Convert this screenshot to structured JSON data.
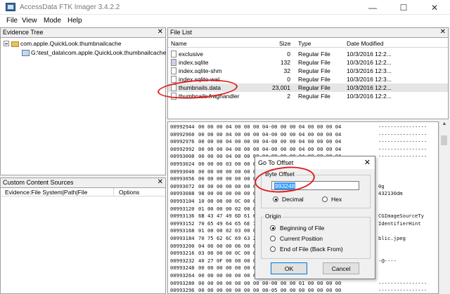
{
  "window": {
    "title": "AccessData FTK Imager 3.4.2.2"
  },
  "menu": [
    "File",
    "View",
    "Mode",
    "Help"
  ],
  "evidence_tree": {
    "header": "Evidence Tree",
    "items": [
      {
        "label": "com.apple.QuickLook.thumbnailcache",
        "icon": "folder-icon"
      },
      {
        "label": "G:\\test_data\\com.apple.QuickLook.thumbnailcache",
        "icon": "drive-icon"
      }
    ]
  },
  "file_list": {
    "header": "File List",
    "columns": [
      "Name",
      "Size",
      "Type",
      "Date Modified"
    ],
    "rows": [
      {
        "name": "exclusive",
        "size": "0",
        "type": "Regular File",
        "date": "10/3/2016 12:2..."
      },
      {
        "name": "index.sqlite",
        "size": "132",
        "type": "Regular File",
        "date": "10/3/2016 12:2..."
      },
      {
        "name": "index.sqlite-shm",
        "size": "32",
        "type": "Regular File",
        "date": "10/3/2016 12:3..."
      },
      {
        "name": "index.sqlite-wal",
        "size": "0",
        "type": "Regular File",
        "date": "10/3/2016 12:3..."
      },
      {
        "name": "thumbnails.data",
        "size": "23,001",
        "type": "Regular File",
        "date": "10/3/2016 12:2..."
      },
      {
        "name": "thumbnails.fraghandler",
        "size": "2",
        "type": "Regular File",
        "date": "10/3/2016 12:2..."
      }
    ]
  },
  "custom_content": {
    "header": "Custom Content Sources",
    "columns": [
      "Evidence:File System|Path|File",
      "Options"
    ]
  },
  "hex_view": {
    "rows": [
      {
        "offset": "00992944",
        "bytes": "00 00 00 04 00 00 00 04-00 00 00 04 00 00 00 04",
        "ascii": "----------------"
      },
      {
        "offset": "00992960",
        "bytes": "00 00 00 04 00 00 00 04-00 00 00 04 00 00 00 04",
        "ascii": "----------------"
      },
      {
        "offset": "00992976",
        "bytes": "00 00 00 04 00 00 00 04-00 00 00 04 00 00 00 04",
        "ascii": "----------------"
      },
      {
        "offset": "00992992",
        "bytes": "00 00 00 04 00 00 00 04-00 00 00 04 00 00 00 04",
        "ascii": "----------------"
      },
      {
        "offset": "00993008",
        "bytes": "00 00 00 04 00 00 00 04-00 00 00 04 00 00 00 04",
        "ascii": "----------------"
      },
      {
        "offset": "00993024",
        "bytes": "00 00 00 03 00 00 00",
        "ascii": ""
      },
      {
        "offset": "00993040",
        "bytes": "00 00 00 00 00 00 00",
        "ascii": ""
      },
      {
        "offset": "00993056",
        "bytes": "00 00 00 00 00 00 00",
        "ascii": ""
      },
      {
        "offset": "00993072",
        "bytes": "00 00 00 00 00 00 00",
        "ascii": "0g"
      },
      {
        "offset": "00993088",
        "bytes": "98 00 00 00 00 00 00",
        "ascii": "432130dm"
      },
      {
        "offset": "00993104",
        "bytes": "10 00 00 00 0C 00 00",
        "ascii": ""
      },
      {
        "offset": "00993120",
        "bytes": "01 00 00 00 02 00 00",
        "ascii": ""
      },
      {
        "offset": "00993136",
        "bytes": "6B 43 47 49 6D 61 67",
        "ascii": "CGImageSourceTy"
      },
      {
        "offset": "00993152",
        "bytes": "70 65 49 64 65 6E 74",
        "ascii": "IdentifierHint"
      },
      {
        "offset": "00993168",
        "bytes": "01 00 00 02 03 00 00",
        "ascii": ""
      },
      {
        "offset": "00993184",
        "bytes": "70 75 62 6C 69 63 2E",
        "ascii": "blic.jpeg"
      },
      {
        "offset": "00993200",
        "bytes": "04 00 00 00 06 00 00",
        "ascii": ""
      },
      {
        "offset": "00993216",
        "bytes": "03 00 00 00 0C 00 00",
        "ascii": ""
      },
      {
        "offset": "00993232",
        "bytes": "40 27 0F 00 00 00 00",
        "ascii": "-@----"
      },
      {
        "offset": "00993248",
        "bytes": "00 00 00 00 00 00 00",
        "ascii": ""
      },
      {
        "offset": "00993264",
        "bytes": "00 00 00 00 00 00 00",
        "ascii": ""
      },
      {
        "offset": "00993280",
        "bytes": "00 00 00 00 00 00 00 00-00 00 00 01 00 00 00 00",
        "ascii": "----------------"
      },
      {
        "offset": "00993296",
        "bytes": "00 00 00 00 00 00 00 00-05 00 00 00 00 00 00 00",
        "ascii": "----------------"
      }
    ]
  },
  "dialog": {
    "title": "Go To Offset",
    "close": "✕",
    "byte_offset_label": "Byte Offset",
    "offset_value": "993248",
    "decimal_label": "Decimal",
    "hex_label": "Hex",
    "origin_label": "Origin",
    "origin_options": [
      "Beginning of File",
      "Current Position",
      "End of File (Back From)"
    ],
    "ok_label": "OK",
    "cancel_label": "Cancel"
  },
  "colors": {
    "annotation": "#e02020",
    "selection": "#3399ff",
    "titlebar": "#ffffff"
  }
}
